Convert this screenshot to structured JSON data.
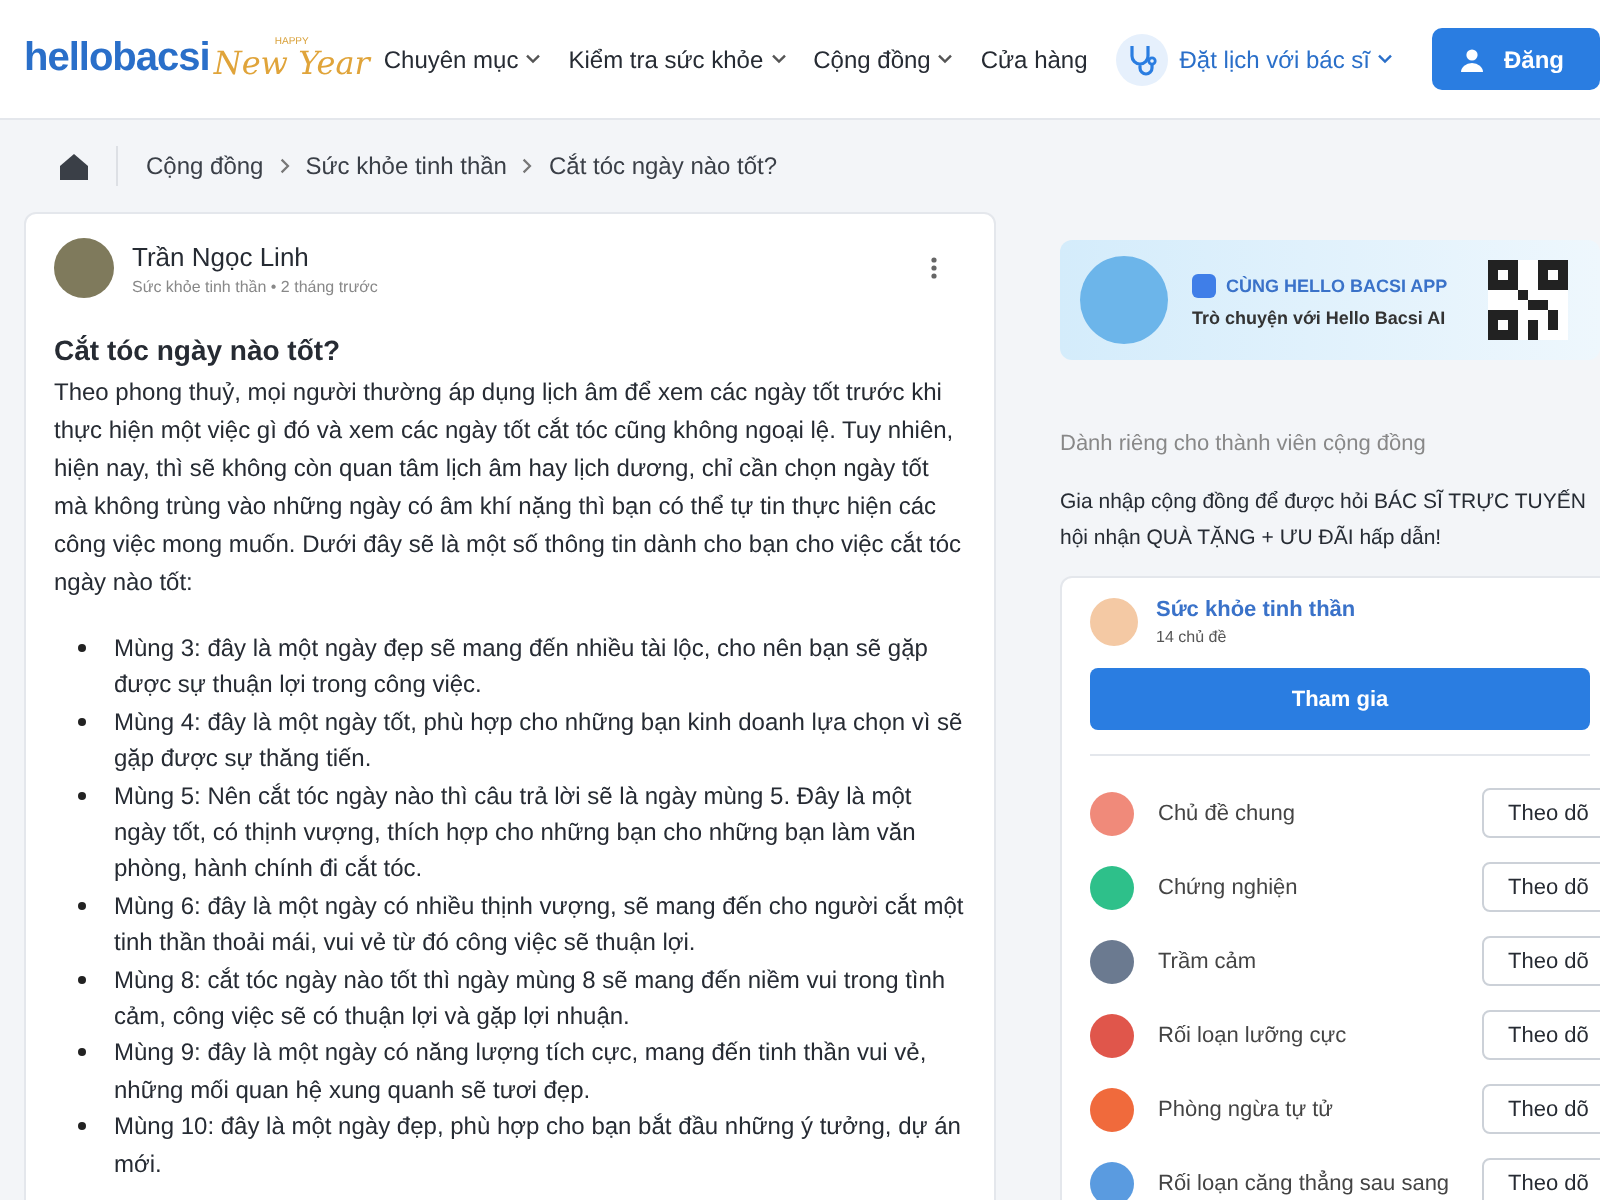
{
  "header": {
    "logo": {
      "text": "hellobacsi",
      "badge_top": "HAPPY",
      "badge_script": "New Year"
    },
    "nav": [
      {
        "label": "Chuyên mục",
        "dropdown": true
      },
      {
        "label": "Kiểm tra sức khỏe",
        "dropdown": true
      },
      {
        "label": "Cộng đồng",
        "dropdown": true
      },
      {
        "label": "Cửa hàng",
        "dropdown": false
      }
    ],
    "booking": {
      "label": "Đặt lịch với bác sĩ"
    },
    "login_button": "Đăng"
  },
  "breadcrumb": [
    "Cộng đồng",
    "Sức khỏe tinh thần",
    "Cắt tóc ngày nào tốt?"
  ],
  "post": {
    "author": "Trần Ngọc Linh",
    "meta": "Sức khỏe tinh thần • 2 tháng trước",
    "title": "Cắt tóc ngày nào tốt?",
    "intro": "Theo phong thuỷ, mọi người thường áp dụng lịch âm để xem các ngày tốt trước khi thực hiện một việc gì đó và xem các ngày tốt cắt tóc cũng không ngoại lệ. Tuy nhiên, hiện nay, thì sẽ không còn quan tâm lịch âm hay lịch dương, chỉ cần chọn ngày tốt mà không trùng vào những ngày có âm khí nặng thì bạn có thể tự tin thực hiện các công việc mong muốn. Dưới đây sẽ là một số thông tin dành cho bạn cho việc cắt tóc ngày nào tốt:",
    "bullets": [
      "Mùng 3: đây là một ngày đẹp sẽ mang đến nhiều tài lộc, cho nên bạn sẽ gặp được sự thuận lợi trong công việc.",
      "Mùng 4: đây là một ngày tốt, phù hợp cho những bạn kinh doanh lựa chọn vì sẽ gặp được sự thăng tiến.",
      "Mùng 5: Nên cắt tóc ngày nào thì câu trả lời sẽ là ngày mùng 5. Đây là một ngày tốt, có thịnh vượng, thích hợp cho những bạn cho những bạn làm văn phòng, hành chính đi cắt tóc.",
      "Mùng 6: đây là một ngày có nhiều thịnh vượng, sẽ mang đến cho người cắt một tinh thần thoải mái, vui vẻ từ đó công việc sẽ thuận lợi.",
      "Mùng 8: cắt tóc ngày nào tốt thì ngày mùng 8 sẽ mang đến niềm vui trong tình cảm, công việc sẽ có thuận lợi và gặp lợi nhuận.",
      "Mùng 9: đây là một ngày có năng lượng tích cực, mang đến tinh thần vui vẻ, những mối quan hệ xung quanh sẽ tươi đẹp.",
      "Mùng 10: đây là một ngày đẹp, phù hợp cho bạn bắt đầu những ý tưởng, dự án mới."
    ]
  },
  "sidebar": {
    "banner": {
      "title": "CÙNG HELLO BACSI APP",
      "subtitle": "Trò chuyện với Hello Bacsi AI"
    },
    "members_heading": "Dành riêng cho thành viên cộng đồng",
    "members_text": [
      "Gia nhập cộng đồng để được hỏi BÁC SĨ TRỰC TUYẾN",
      "hội nhận QUÀ TẶNG + ƯU ĐÃI hấp dẫn!"
    ],
    "community": {
      "name": "Sức khỏe tinh thần",
      "count": "14 chủ đề",
      "join_button": "Tham gia",
      "topics": [
        {
          "name": "Chủ đề chung",
          "color": "#f08a7a",
          "follow": "Theo dõ"
        },
        {
          "name": "Chứng nghiện",
          "color": "#2ec08a",
          "follow": "Theo dõ"
        },
        {
          "name": "Trầm cảm",
          "color": "#6b7a90",
          "follow": "Theo dõ"
        },
        {
          "name": "Rối loạn lưỡng cực",
          "color": "#e0564b",
          "follow": "Theo dõ"
        },
        {
          "name": "Phòng ngừa tự tử",
          "color": "#f06a3c",
          "follow": "Theo dõ"
        },
        {
          "name": "Rối loạn căng thẳng sau sang",
          "color": "#5a9be0",
          "follow": "Theo dõ"
        }
      ]
    }
  }
}
